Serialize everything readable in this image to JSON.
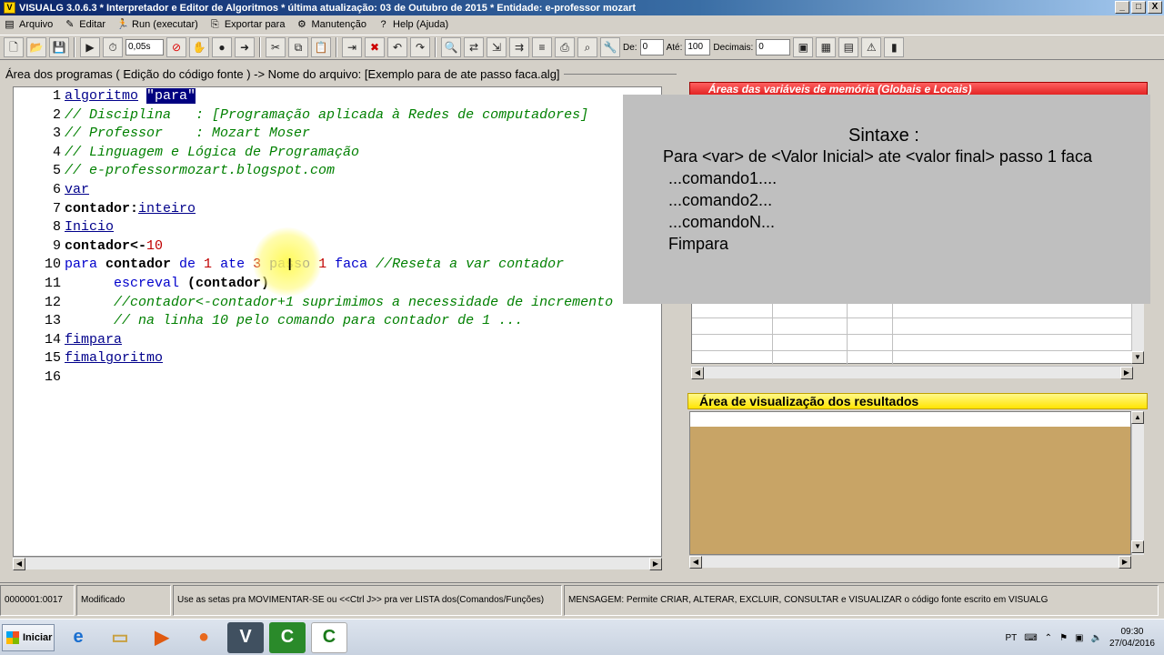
{
  "window": {
    "title": "VISUALG 3.0.6.3 * Interpretador e Editor de Algoritmos * última atualização: 03 de Outubro de 2015 * Entidade: e-professor mozart",
    "controls": [
      "_",
      "□",
      "X"
    ]
  },
  "menu": [
    "Arquivo",
    "Editar",
    "Run (executar)",
    "Exportar para",
    "Manutenção",
    "Help (Ajuda)"
  ],
  "toolbar": {
    "speed": "0,05s",
    "de_label": "De:",
    "de_value": "0",
    "ate_label": "Até:",
    "ate_value": "100",
    "decimais_label": "Decimais:",
    "decimais_value": "0"
  },
  "editor": {
    "panel_title": "Área dos programas ( Edição do código fonte ) -> Nome do arquivo: [Exemplo para de ate passo faca.alg]",
    "lines": [
      {
        "n": "1",
        "parts": [
          {
            "t": "algoritmo",
            "c": "kw"
          },
          {
            "t": " ",
            "c": ""
          },
          {
            "t": "\"para\"",
            "c": "sel"
          }
        ]
      },
      {
        "n": "2",
        "parts": [
          {
            "t": "// Disciplina   : [Programação aplicada à Redes de computadores]",
            "c": "cm"
          }
        ]
      },
      {
        "n": "3",
        "parts": [
          {
            "t": "// Professor    : Mozart Moser",
            "c": "cm"
          }
        ]
      },
      {
        "n": "4",
        "parts": [
          {
            "t": "// Linguagem e Lógica de Programação",
            "c": "cm"
          }
        ]
      },
      {
        "n": "5",
        "parts": [
          {
            "t": "// e-professormozart.blogspot.com",
            "c": "cm"
          }
        ]
      },
      {
        "n": "6",
        "parts": [
          {
            "t": "var",
            "c": "kw"
          }
        ]
      },
      {
        "n": "7",
        "parts": [
          {
            "t": "contador:",
            "c": "bold"
          },
          {
            "t": "inteiro",
            "c": "kw"
          }
        ]
      },
      {
        "n": "8",
        "parts": [
          {
            "t": "Inicio",
            "c": "kw"
          }
        ]
      },
      {
        "n": "9",
        "parts": [
          {
            "t": "contador<-",
            "c": "bold"
          },
          {
            "t": "10",
            "c": "num"
          }
        ]
      },
      {
        "n": "10",
        "parts": [
          {
            "t": "para ",
            "c": "blue"
          },
          {
            "t": "contador",
            "c": "bold"
          },
          {
            "t": " de ",
            "c": "blue"
          },
          {
            "t": "1",
            "c": "num"
          },
          {
            "t": " ate ",
            "c": "blue"
          },
          {
            "t": "3",
            "c": "num"
          },
          {
            "t": " passo ",
            "c": "blue"
          },
          {
            "t": "1",
            "c": "num"
          },
          {
            "t": " faca ",
            "c": "blue"
          },
          {
            "t": "//Reseta a var contador",
            "c": "cm"
          }
        ]
      },
      {
        "n": "11",
        "parts": [
          {
            "t": "      escreval ",
            "c": "blue"
          },
          {
            "t": "(contador)",
            "c": "bold"
          }
        ]
      },
      {
        "n": "12",
        "parts": [
          {
            "t": "      //contador<-contador+1 suprimimos a necessidade de incremento",
            "c": "cm"
          }
        ]
      },
      {
        "n": "13",
        "parts": [
          {
            "t": "      // na linha 10 pelo comando para contador de 1 ...",
            "c": "cm"
          }
        ]
      },
      {
        "n": "14",
        "parts": [
          {
            "t": "fimpara",
            "c": "kw"
          }
        ]
      },
      {
        "n": "15",
        "parts": [
          {
            "t": "fimalgoritmo",
            "c": "kw"
          }
        ]
      },
      {
        "n": "16",
        "parts": []
      }
    ]
  },
  "variables": {
    "header": "Áreas das variáveis de memória (Globais e Locais)"
  },
  "tooltip": {
    "title": "Sintaxe :",
    "lines": [
      "Para <var> de <Valor Inicial> ate <valor final> passo 1 faca",
      "...comando1....",
      "...comando2...",
      "...comandoN...",
      "Fimpara"
    ]
  },
  "results": {
    "header": "Área de visualização dos resultados"
  },
  "status": {
    "position": "0000001:0017",
    "state": "Modificado",
    "hint": "Use as setas pra MOVIMENTAR-SE ou <<Ctrl J>> pra ver LISTA dos(Comandos/Funções)",
    "message": "MENSAGEM: Permite CRIAR, ALTERAR, EXCLUIR, CONSULTAR e VISUALIZAR o código fonte escrito em VISUALG"
  },
  "taskbar": {
    "start": "Iniciar",
    "lang": "PT",
    "time": "09:30",
    "date": "27/04/2016"
  }
}
